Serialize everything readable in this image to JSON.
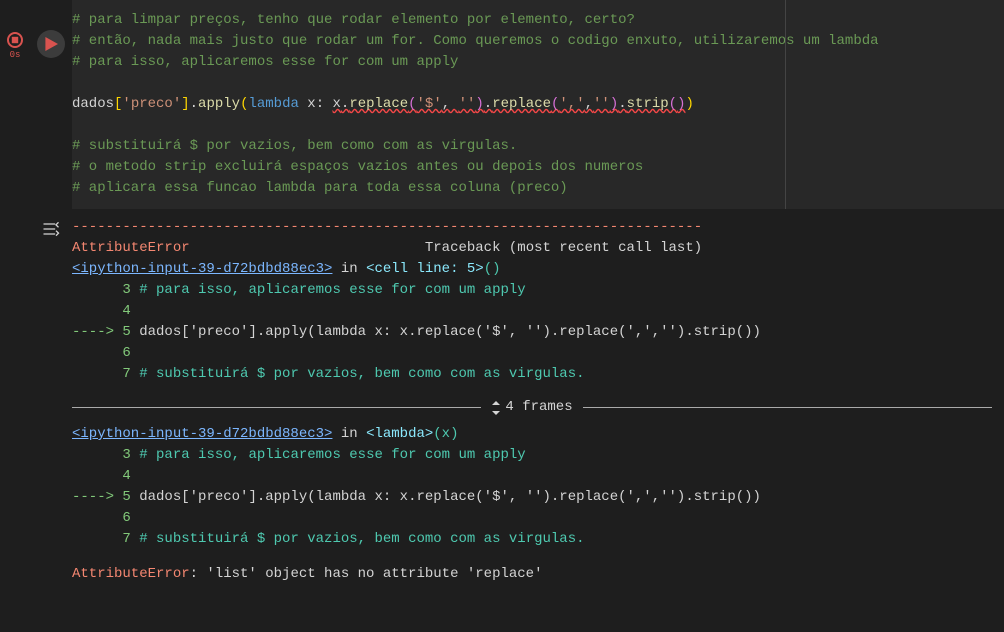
{
  "gutter": {
    "timer": "0s"
  },
  "code": {
    "c1": "# para limpar preços, tenho que rodar elemento por elemento, certo?",
    "c2": "# então, nada mais justo que rodar um for. Como queremos o codigo enxuto, utilizaremos um lambda",
    "c3": "# para isso, aplicaremos esse for com um apply",
    "expr": {
      "dados": "dados",
      "lb": "[",
      "preco": "'preco'",
      "rb": "]",
      "dot1": ".",
      "apply": "apply",
      "lp1": "(",
      "lambda": "lambda",
      "xcol": " x: ",
      "x": "x",
      "dot2": ".",
      "replace1": "replace",
      "lp2": "(",
      "dollar": "'$'",
      "comma1": ", ",
      "empty1": "''",
      "rp2": ")",
      "dot3": ".",
      "replace2": "replace",
      "lp3": "(",
      "comma_str": "','",
      "comma2": ",",
      "empty2": "''",
      "rp3": ")",
      "dot4": ".",
      "strip": "strip",
      "lp4": "(",
      "rp4": ")",
      "rp1": ")"
    },
    "c4": "# substituirá $ por vazios, bem como com as virgulas.",
    "c5": "# o metodo strip excluirá espaços vazios antes ou depois dos numeros",
    "c6": "# aplicara essa funcao lambda para toda essa coluna (preco)"
  },
  "output": {
    "error_name": "AttributeError",
    "traceback_label": "Traceback (most recent call last)",
    "link": "<ipython-input-39-d72bdbd88ec3>",
    "in": " in ",
    "cell_line": "<cell line: 5>",
    "parens": "()",
    "lambda_loc": "<lambda>",
    "lambda_arg": "(x)",
    "ln3": "3",
    "ln3_txt": " # para isso, aplicaremos esse for com um apply",
    "ln4": "4",
    "ln5": "5",
    "ln5_txt": " dados['preco'].apply(lambda x: x.replace('$', '').replace(',','').strip())",
    "arrow": "----> ",
    "ln6": "6",
    "ln7": "7",
    "ln7_txt": " # substituirá $ por vazios, bem como com as virgulas.",
    "frames": "4 frames",
    "final_error": "AttributeError",
    "final_msg": ": 'list' object has no attribute 'replace'"
  }
}
